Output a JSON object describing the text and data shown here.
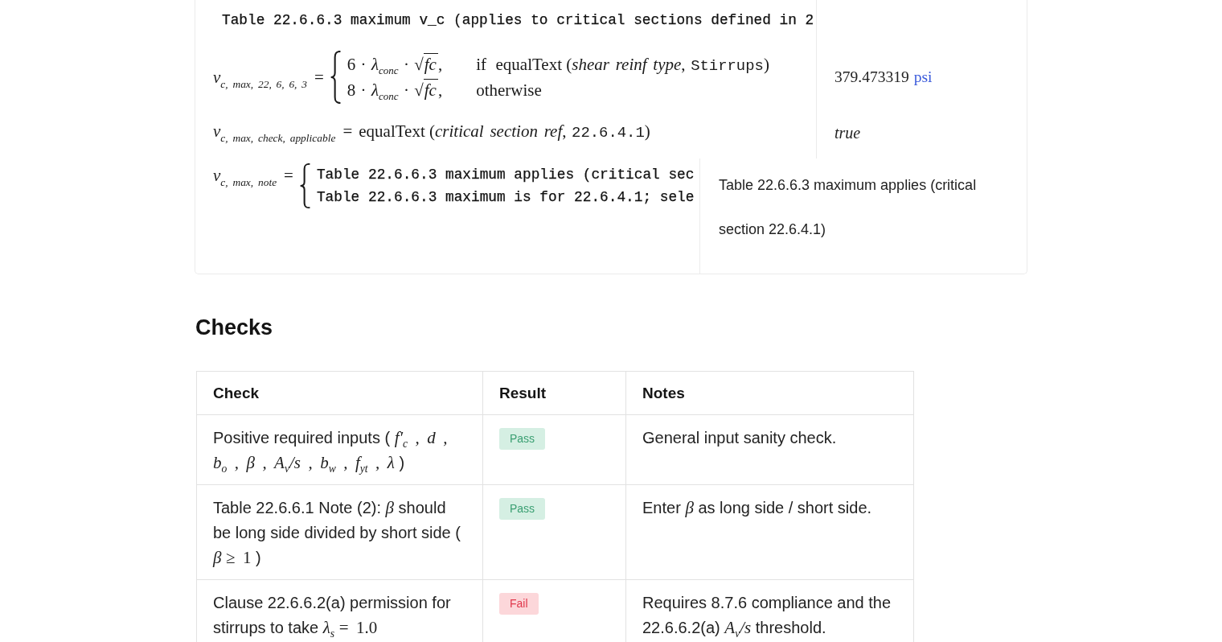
{
  "calc_card": {
    "title": "Table 22.6.6.3 maximum v_c (applies to critical sections defined in 2",
    "formulas": [
      {
        "kind": "cases",
        "lhs": "v$_{c, max, 22, 6, 6, 3}$",
        "relation": "=",
        "cases": [
          {
            "expr": [
              {
                "kind": "num",
                "text": "6"
              },
              {
                "kind": "op",
                "text": "·"
              },
              {
                "kind": "sym",
                "text": "λ$_{conc}$"
              },
              {
                "kind": "op",
                "text": "·"
              },
              {
                "kind": "sqrt",
                "sign": "√",
                "text": "fc"
              },
              {
                "kind": "punct",
                "text": ","
              }
            ],
            "condition": [
              {
                "kind": "roman",
                "text": "if"
              },
              {
                "kind": "roman",
                "text": "equalText"
              },
              {
                "kind": "open",
                "text": "("
              },
              {
                "kind": "sym",
                "text": "shear reinf type"
              },
              {
                "kind": "punct",
                "text": ","
              },
              {
                "kind": "mono",
                "text": "Stirrups"
              },
              {
                "kind": "close",
                "text": ")"
              }
            ]
          },
          {
            "expr": [
              {
                "kind": "num",
                "text": "8"
              },
              {
                "kind": "op",
                "text": "·"
              },
              {
                "kind": "sym",
                "text": "λ$_{conc}$"
              },
              {
                "kind": "op",
                "text": "·"
              },
              {
                "kind": "sqrt",
                "sign": "√",
                "text": "fc"
              },
              {
                "kind": "punct",
                "text": ","
              }
            ],
            "condition": [
              {
                "kind": "roman",
                "text": "otherwise"
              }
            ]
          }
        ],
        "result": {
          "kind": "quantity",
          "value": "379.473319",
          "unit": "psi"
        }
      },
      {
        "kind": "expression",
        "lhs": "v$_{c, max, check, applicable}$",
        "relation": "=",
        "rhs": [
          {
            "kind": "roman",
            "text": "equalText"
          },
          {
            "kind": "open",
            "text": "("
          },
          {
            "kind": "sym",
            "text": "critical section ref"
          },
          {
            "kind": "punct",
            "text": ","
          },
          {
            "kind": "mono",
            "text": "22.6.4.1"
          },
          {
            "kind": "close",
            "text": ")"
          }
        ],
        "result": {
          "kind": "boolean",
          "value": "true"
        }
      },
      {
        "kind": "text_cases",
        "lhs": "v$_{c, max, note}$",
        "relation": "=",
        "cases": [
          {
            "text": "Table 22.6.6.3 maximum applies (critical sec"
          },
          {
            "text": "Table 22.6.6.3 maximum is for 22.6.4.1; sele"
          }
        ],
        "result": {
          "kind": "note",
          "text": "Table 22.6.6.3 maximum applies (critical section 22.6.4.1)"
        }
      }
    ]
  },
  "checks": {
    "heading": "Checks",
    "columns": [
      "Check",
      "Result",
      "Notes"
    ],
    "rows": [
      {
        "check": [
          {
            "kind": "text",
            "text": "Positive required inputs ("
          },
          {
            "kind": "math",
            "text": "f′$_{c}$ , d , b$_{o}$ , β , A$_{v}$/s , b$_{w}$ , f$_{yt}$ , λ"
          },
          {
            "kind": "text",
            "text": ")"
          }
        ],
        "result": {
          "label": "Pass",
          "passed": true
        },
        "notes": [
          {
            "kind": "text",
            "text": "General input sanity check."
          }
        ]
      },
      {
        "check": [
          {
            "kind": "text",
            "text": "Table 22.6.6.1 Note (2):"
          },
          {
            "kind": "math",
            "text": "β"
          },
          {
            "kind": "text",
            "text": "should be long side divided by short side ("
          },
          {
            "kind": "math",
            "text": "β"
          },
          {
            "kind": "mathrm",
            "text": "≥ 1"
          },
          {
            "kind": "text",
            "text": ")"
          }
        ],
        "result": {
          "label": "Pass",
          "passed": true
        },
        "notes": [
          {
            "kind": "text",
            "text": "Enter"
          },
          {
            "kind": "math",
            "text": "β"
          },
          {
            "kind": "text",
            "text": "as long side / short side."
          }
        ]
      },
      {
        "check": [
          {
            "kind": "text",
            "text": "Clause 22.6.6.2(a) permission for stirrups to take"
          },
          {
            "kind": "math",
            "text": "λ$_{s}$"
          },
          {
            "kind": "mathrm",
            "text": "= 1.0"
          }
        ],
        "result": {
          "label": "Fail",
          "passed": false
        },
        "notes": [
          {
            "kind": "text",
            "text": "Requires 8.7.6 compliance and the 22.6.6.2(a)"
          },
          {
            "kind": "math",
            "text": "A$_{v}$/s"
          },
          {
            "kind": "text",
            "text": "threshold."
          }
        ]
      }
    ]
  }
}
